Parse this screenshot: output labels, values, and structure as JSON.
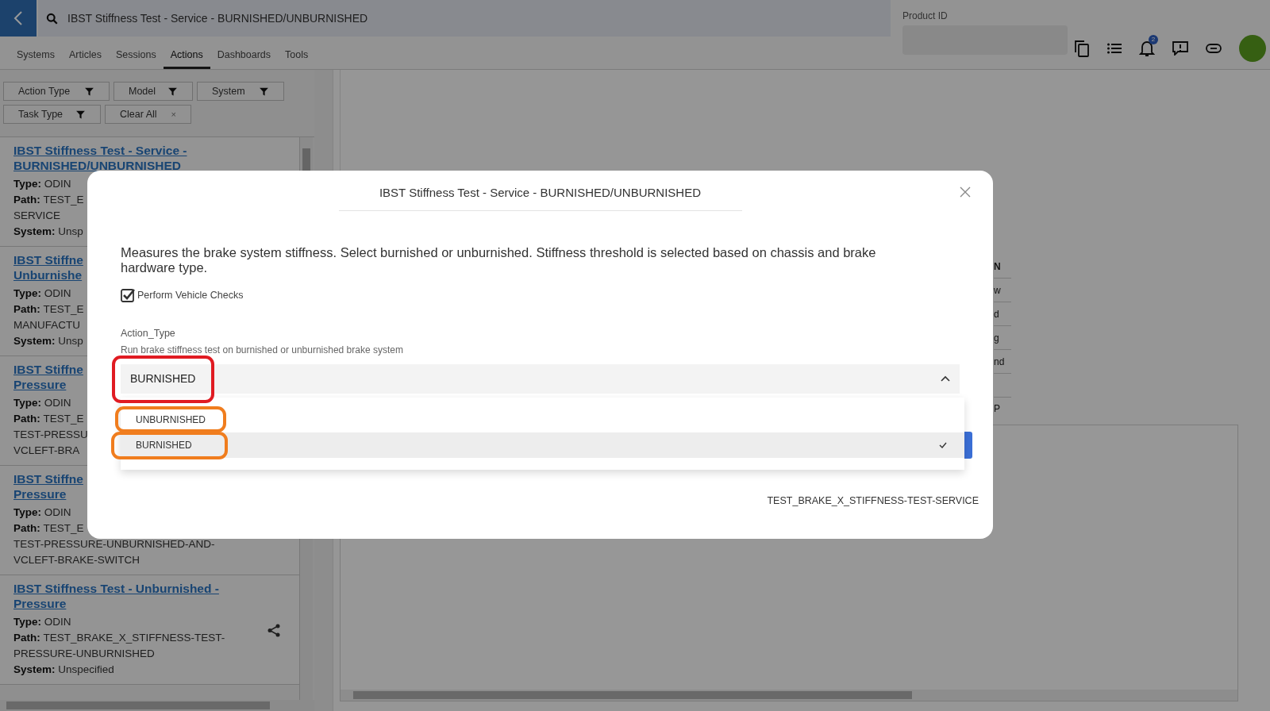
{
  "header": {
    "search_value": "IBST Stiffness Test - Service - BURNISHED/UNBURNISHED",
    "product_id_label": "Product ID",
    "notification_count": "2"
  },
  "tabs": [
    {
      "label": "Systems",
      "selected": false
    },
    {
      "label": "Articles",
      "selected": false
    },
    {
      "label": "Sessions",
      "selected": false
    },
    {
      "label": "Actions",
      "selected": true
    },
    {
      "label": "Dashboards",
      "selected": false
    },
    {
      "label": "Tools",
      "selected": false
    }
  ],
  "filters": [
    [
      {
        "label": "Action Type",
        "kind": "filter"
      },
      {
        "label": "Model",
        "kind": "filter"
      },
      {
        "label": "System",
        "kind": "filter"
      }
    ],
    [
      {
        "label": "Task Type",
        "kind": "filter"
      },
      {
        "label": "Clear All",
        "kind": "clear",
        "icon": "×"
      }
    ]
  ],
  "actions": [
    {
      "title_lines": [
        "IBST Stiffness Test - Service -",
        "BURNISHED/UNBURNISHED"
      ],
      "fields": [
        {
          "label": "Type:",
          "lines": [
            "ODIN"
          ]
        },
        {
          "label": "Path:",
          "lines": [
            "TEST_E",
            "SERVICE"
          ]
        },
        {
          "label": "System:",
          "lines": [
            "Unsp"
          ]
        }
      ]
    },
    {
      "title_lines": [
        "IBST Stiffne",
        "Unburnishe"
      ],
      "fields": [
        {
          "label": "Type:",
          "lines": [
            "ODIN"
          ]
        },
        {
          "label": "Path:",
          "lines": [
            "TEST_E",
            "MANUFACTU"
          ]
        },
        {
          "label": "System:",
          "lines": [
            "Unsp"
          ]
        }
      ]
    },
    {
      "title_lines": [
        "IBST Stiffne",
        "Pressure"
      ],
      "fields": [
        {
          "label": "Type:",
          "lines": [
            "ODIN"
          ]
        },
        {
          "label": "Path:",
          "lines": [
            "TEST_E",
            "TEST-PRESSU",
            "VCLEFT-BRA"
          ]
        }
      ]
    },
    {
      "title_lines": [
        "IBST Stiffne",
        "Pressure"
      ],
      "fields": [
        {
          "label": "Type:",
          "lines": [
            "ODIN"
          ]
        },
        {
          "label": "Path:",
          "lines": [
            "TEST_E",
            "TEST-PRESSURE-UNBURNISHED-AND-",
            "VCLEFT-BRAKE-SWITCH"
          ]
        }
      ]
    },
    {
      "title_lines": [
        "IBST Stiffness Test - Unburnished -",
        "Pressure"
      ],
      "fields": [
        {
          "label": "Type:",
          "lines": [
            "ODIN"
          ]
        },
        {
          "label": "Path:",
          "lines": [
            "TEST_BRAKE_X_STIFFNESS-TEST-",
            "PRESSURE-UNBURNISHED"
          ]
        },
        {
          "label": "System:",
          "lines": [
            "Unspecified"
          ]
        }
      ],
      "share": true
    }
  ],
  "main": {
    "table_fragments": [
      {
        "text": "N",
        "kind": "head"
      },
      {
        "text": "w",
        "kind": "cell"
      },
      {
        "text": "d",
        "kind": "cell"
      },
      {
        "text": "g",
        "kind": "cell"
      },
      {
        "text": "nd",
        "kind": "cell"
      }
    ],
    "section_fragment": "P"
  },
  "dialog": {
    "title": "IBST Stiffness Test - Service - BURNISHED/UNBURNISHED",
    "description": "Measures the brake system stiffness. Select burnished or unburnished. Stiffness threshold is selected based on chassis and brake hardware type.",
    "checkbox": {
      "label": "Perform Vehicle Checks",
      "checked": true
    },
    "field": {
      "label": "Action_Type",
      "hint": "Run brake stiffness test on burnished or unburnished brake system",
      "value": "BURNISHED",
      "expanded": true,
      "highlighted": true
    },
    "options": [
      {
        "label": "UNBURNISHED",
        "selected": false,
        "highlighted": true
      },
      {
        "label": "BURNISHED",
        "selected": true,
        "highlighted": true
      }
    ],
    "footer": "TEST_BRAKE_X_STIFFNESS-TEST-SERVICE"
  }
}
